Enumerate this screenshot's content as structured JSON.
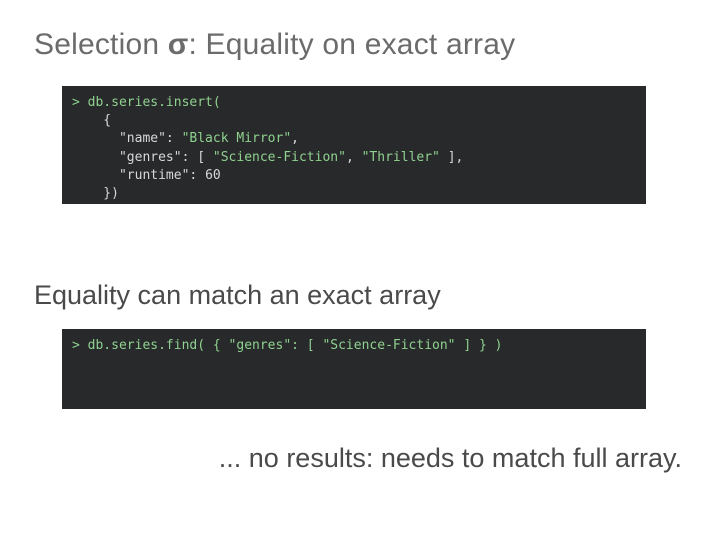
{
  "title_pre": "Selection ",
  "title_sigma": "σ",
  "title_post": ": Equality on exact array",
  "code1": {
    "l1a": "> ",
    "l1b": "db.series.insert(",
    "l2": "    {",
    "l3a": "      \"name\": ",
    "l3b": "\"Black Mirror\"",
    "l3c": ",",
    "l4a": "      \"genres\": [ ",
    "l4b": "\"Science-Fiction\"",
    "l4c": ", ",
    "l4d": "\"Thriller\"",
    "l4e": " ],",
    "l5a": "      \"runtime\": ",
    "l5b": "60",
    "l6": "    })"
  },
  "subhead": "Equality can match an exact array",
  "code2": {
    "l1a": "> ",
    "l1b": "db.series.find( { \"genres\": [ \"Science-Fiction\" ] } )"
  },
  "footnote": "... no results: needs to match full array."
}
